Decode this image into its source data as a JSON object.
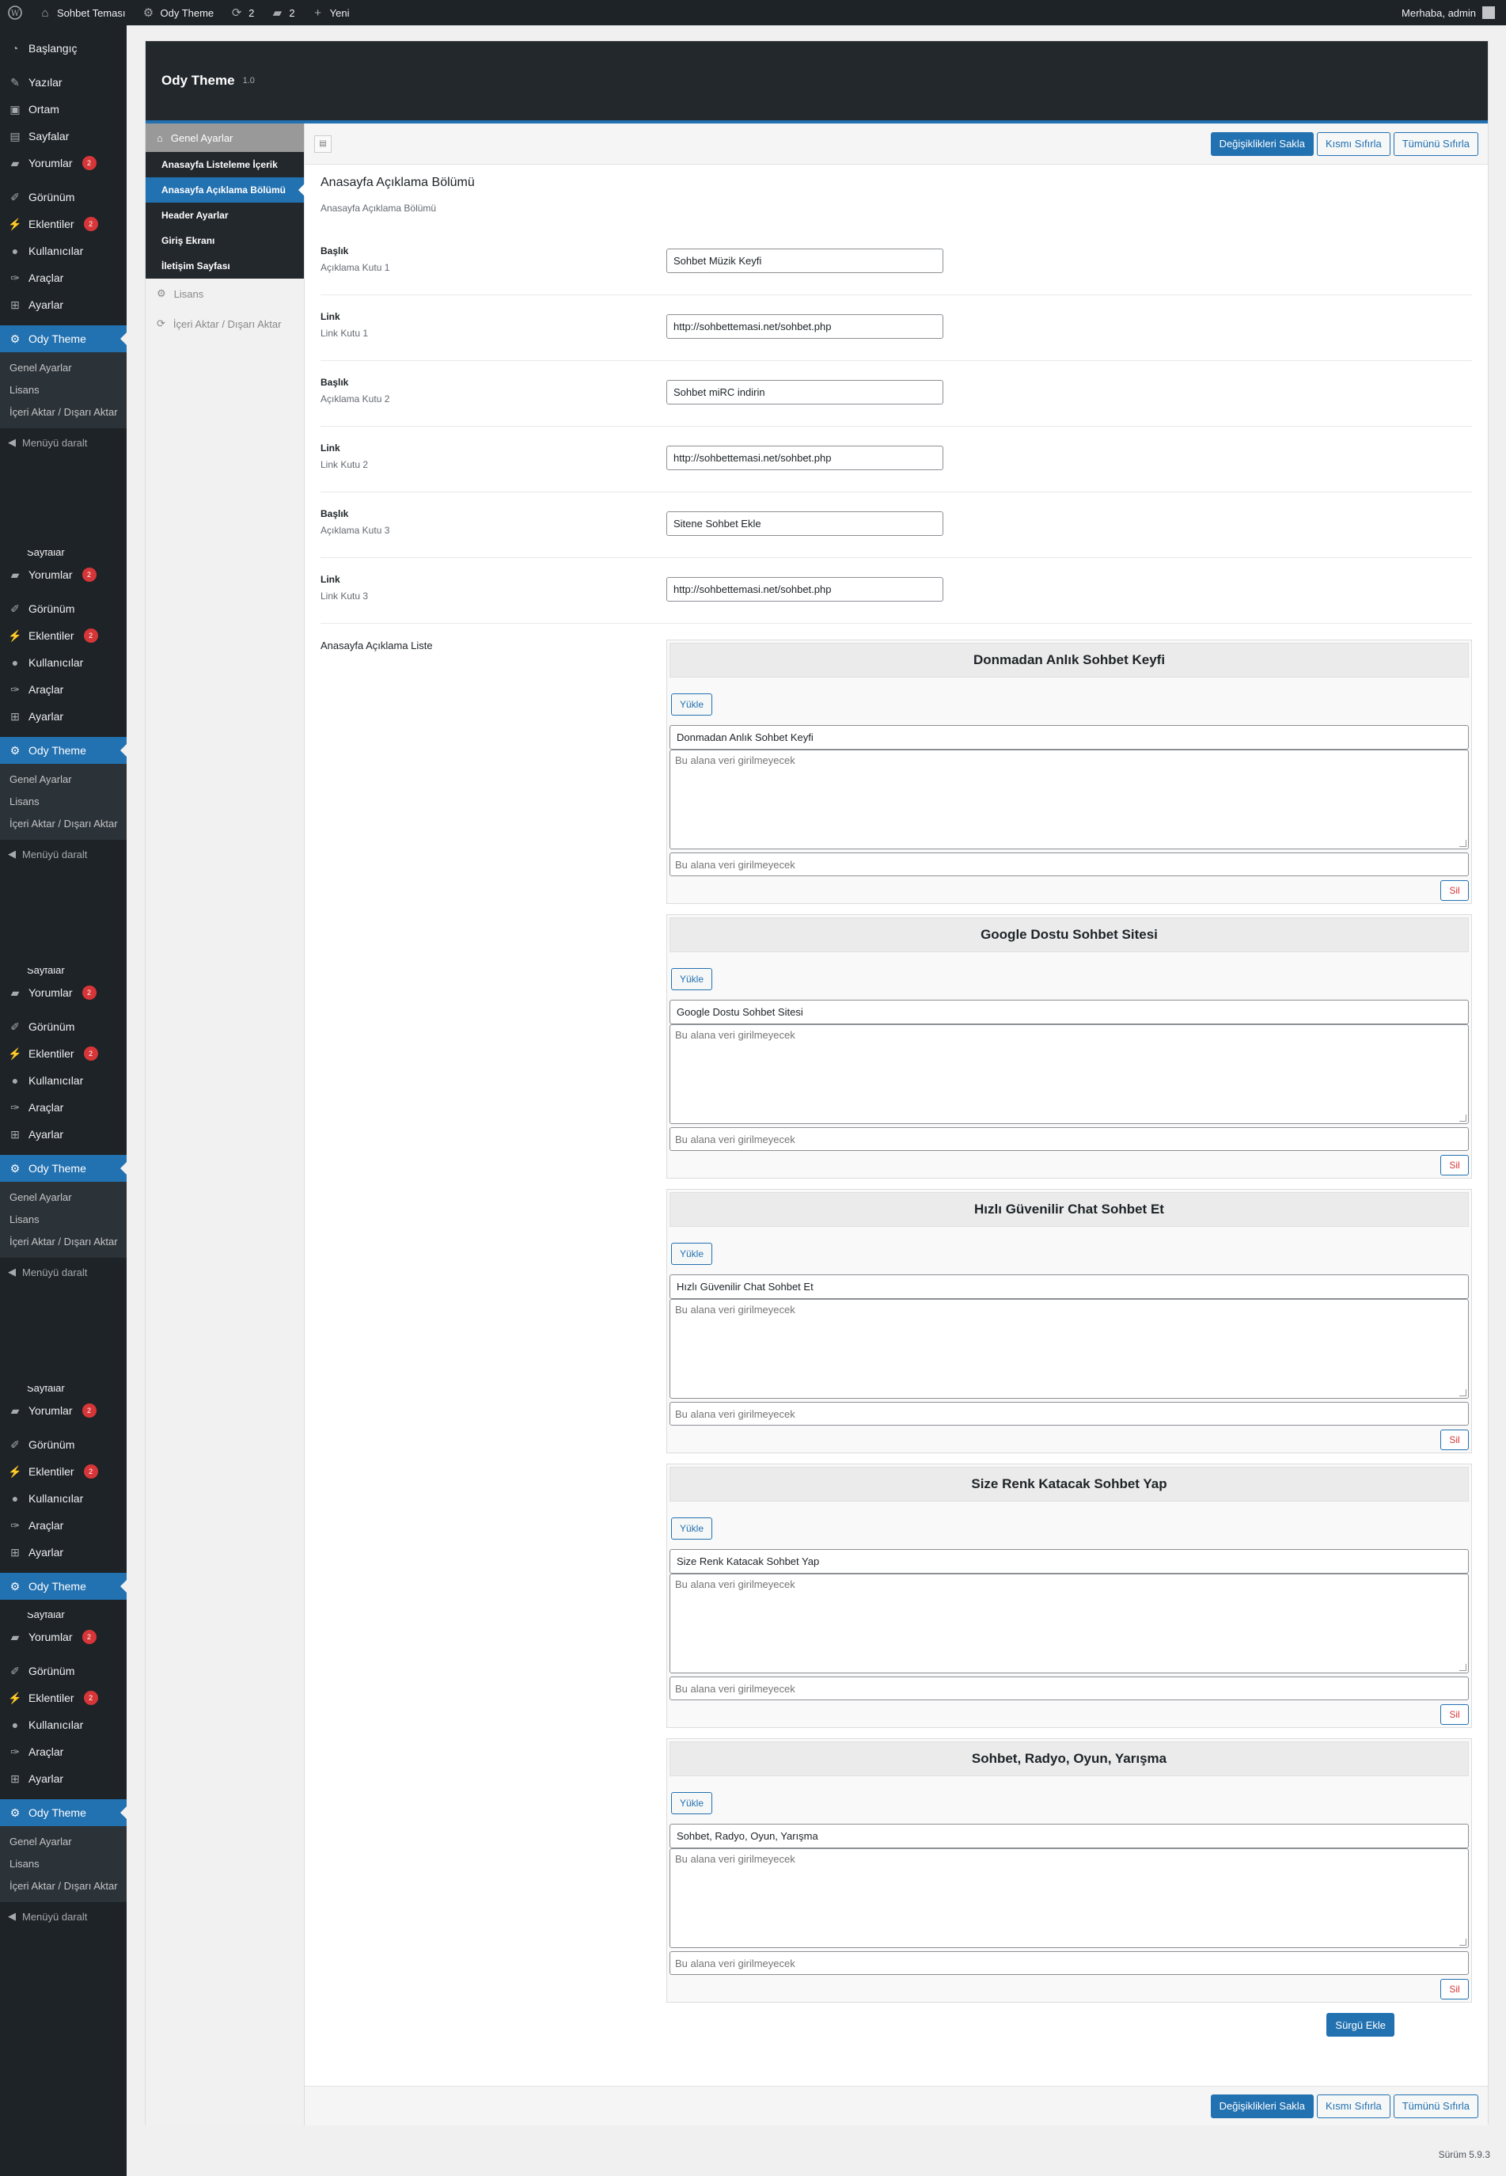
{
  "adminbar": {
    "site_name": "Sohbet Teması",
    "theme_name": "Ody Theme",
    "updates_count": "2",
    "comments_count": "2",
    "new_label": "Yeni",
    "greeting": "Merhaba, admin"
  },
  "sidebar": {
    "dashboard": "Başlangıç",
    "posts": "Yazılar",
    "media": "Ortam",
    "pages": "Sayfalar",
    "comments": "Yorumlar",
    "comments_badge": "2",
    "appearance": "Görünüm",
    "plugins": "Eklentiler",
    "plugins_badge": "2",
    "users": "Kullanıcılar",
    "tools": "Araçlar",
    "settings": "Ayarlar",
    "ody_theme": "Ody Theme",
    "sub_general": "Genel Ayarlar",
    "sub_license": "Lisans",
    "sub_import": "İçeri Aktar / Dışarı Aktar",
    "collapse": "Menüyü daralt",
    "cut_pages": "Sayfalar"
  },
  "panel": {
    "title": "Ody Theme",
    "version": "1.0",
    "nav": {
      "general": "Genel Ayarlar",
      "subs": [
        "Anasayfa Listeleme İçerik",
        "Anasayfa Açıklama Bölümü",
        "Header Ayarlar",
        "Giriş Ekranı",
        "İletişim Sayfası"
      ],
      "license": "Lisans",
      "import": "İçeri Aktar / Dışarı Aktar"
    },
    "buttons": {
      "save": "Değişiklikleri Sakla",
      "reset_section": "Kısmı Sıfırla",
      "reset_all": "Tümünü Sıfırla"
    },
    "section": {
      "title": "Anasayfa Açıklama Bölümü",
      "desc": "Anasayfa Açıklama Bölümü"
    },
    "fields": [
      {
        "label": "Başlık",
        "desc": "Açıklama Kutu 1",
        "value": "Sohbet Müzik Keyfi"
      },
      {
        "label": "Link",
        "desc": "Link Kutu 1",
        "value": "http://sohbettemasi.net/sohbet.php"
      },
      {
        "label": "Başlık",
        "desc": "Açıklama Kutu 2",
        "value": "Sohbet miRC indirin"
      },
      {
        "label": "Link",
        "desc": "Link Kutu 2",
        "value": "http://sohbettemasi.net/sohbet.php"
      },
      {
        "label": "Başlık",
        "desc": "Açıklama Kutu 3",
        "value": "Sitene   Sohbet Ekle"
      },
      {
        "label": "Link",
        "desc": "Link Kutu 3",
        "value": "http://sohbettemasi.net/sohbet.php"
      }
    ],
    "list": {
      "label": "Anasayfa Açıklama Liste",
      "upload": "Yükle",
      "delete": "Sil",
      "placeholder": "Bu alana veri girilmeyecek",
      "add": "Sürgü Ekle",
      "slides": [
        {
          "header": "Donmadan Anlık Sohbet Keyfi",
          "title": "Donmadan Anlık Sohbet Keyfi"
        },
        {
          "header": "Google Dostu Sohbet Sitesi",
          "title": "Google Dostu Sohbet Sitesi"
        },
        {
          "header": "Hızlı Güvenilir Chat Sohbet Et",
          "title": "Hızlı Güvenilir Chat Sohbet Et"
        },
        {
          "header": "Size Renk Katacak Sohbet Yap",
          "title": "Size  Renk Katacak Sohbet Yap"
        },
        {
          "header": "Sohbet, Radyo, Oyun, Yarışma",
          "title": "Sohbet, Radyo, Oyun, Yarışma"
        }
      ]
    }
  },
  "footer": {
    "version": "Sürüm 5.9.3"
  },
  "colors": {
    "accent": "#2271b1",
    "admin_dark": "#1d2327",
    "badge": "#d63638"
  }
}
